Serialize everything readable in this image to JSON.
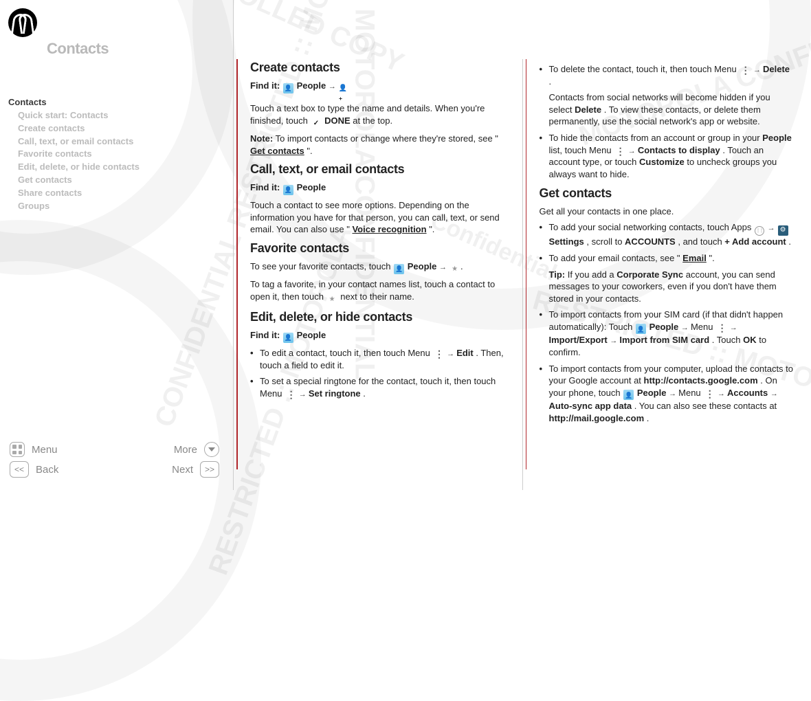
{
  "header": {
    "title": "Contacts"
  },
  "nav": {
    "top": "Contacts",
    "items": [
      "Quick start: Contacts",
      "Create contacts",
      "Call, text, or email contacts",
      "Favorite contacts",
      "Edit, delete, or hide contacts",
      "Get contacts",
      "Share contacts",
      "Groups"
    ]
  },
  "bottom": {
    "menu": "Menu",
    "more": "More",
    "back": "Back",
    "next": "Next",
    "prev_glyph": "<<",
    "next_glyph": ">>"
  },
  "col1": {
    "h_create": "Create contacts",
    "findit_label": "Find it:",
    "findit_people": "People",
    "create_p1a": "Touch a text box to type the name and details. When you're finished, touch ",
    "done": "DONE",
    "create_p1b": " at the top.",
    "note_label": "Note:",
    "note_text_a": " To import contacts or change where they're stored, see \"",
    "note_link": "Get contacts",
    "note_text_b": "\".",
    "h_call": "Call, text, or email contacts",
    "call_p1a": "Touch a contact to see more options. Depending on the information you have for that person, you can call, text, or send email. You can also use \"",
    "call_link": "Voice recognition",
    "call_p1b": "\".",
    "h_fav": "Favorite contacts",
    "fav_p1": "To see your favorite contacts, touch ",
    "fav_p2": "To tag a favorite, in your contact names list, touch a contact to open it, then touch ",
    "fav_p2b": " next to their name.",
    "h_edit": "Edit, delete, or hide contacts",
    "edit_li1_a": "To edit a contact, touch it, then touch Menu ",
    "edit_li1_b": "Edit",
    "edit_li1_c": ". Then, touch a field to edit it.",
    "edit_li2_a": "To set a special ringtone for the contact, touch it, then touch Menu ",
    "edit_li2_b": "Set ringtone",
    "edit_li2_c": "."
  },
  "col2": {
    "del_li1_a": "To delete the contact, touch it, then touch Menu ",
    "del_li1_b": "Delete",
    "del_li1_c": ".",
    "del_p_a": "Contacts from social networks will become hidden if you select ",
    "del_p_b": "Delete",
    "del_p_c": ". To view these contacts, or delete them permanently, use the social network's app or website.",
    "hide_li_a": "To hide the contacts from an account or group in your ",
    "hide_li_b": "People",
    "hide_li_c": " list, touch Menu ",
    "hide_li_d": "Contacts to display",
    "hide_li_e": ". Touch an account type, or touch ",
    "hide_li_f": "Customize",
    "hide_li_g": " to uncheck groups you always want to hide.",
    "h_get": "Get contacts",
    "get_intro": "Get all your contacts in one place.",
    "get_li1_a": "To add your social networking contacts, touch Apps ",
    "get_li1_b": "Settings",
    "get_li1_c": ", scroll to ",
    "get_li1_d": "ACCOUNTS",
    "get_li1_e": ", and touch ",
    "get_li1_f": "+ Add account",
    "get_li1_g": ".",
    "get_li2_a": "To add your email contacts, see \"",
    "get_li2_b": "Email",
    "get_li2_c": "\".",
    "tip_label": "Tip:",
    "tip_text_a": " If you add a ",
    "tip_text_b": "Corporate Sync",
    "tip_text_c": " account, you can send messages to your coworkers, even if you don't have them stored in your contacts.",
    "get_li3_a": "To import contacts from your SIM card (if that didn't happen automatically): Touch ",
    "get_li3_b": "People",
    "get_li3_c": " Menu ",
    "get_li3_d": "Import/Export",
    "get_li3_e": "Import from SIM card",
    "get_li3_f": ". Touch ",
    "get_li3_g": "OK",
    "get_li3_h": " to confirm.",
    "get_li4_a": "To import contacts from your computer, upload the contacts to your Google account at ",
    "get_li4_url1": "http://contacts.google.com",
    "get_li4_b": ". On your phone, touch ",
    "get_li4_c": "People",
    "get_li4_d": " Menu ",
    "get_li4_e": "Accounts",
    "get_li4_f": "Auto-sync app data",
    "get_li4_g": ". You can also see these contacts at ",
    "get_li4_url2": "http://mail.google.com",
    "get_li4_h": "."
  }
}
